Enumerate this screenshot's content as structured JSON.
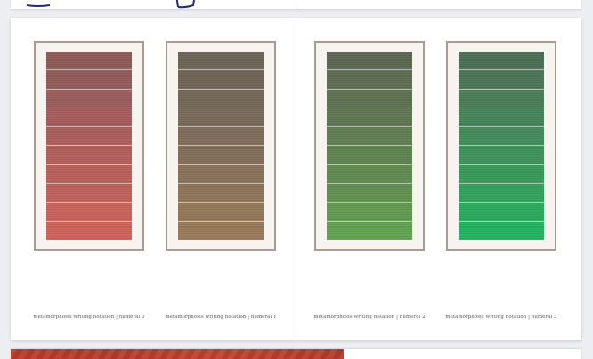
{
  "works": [
    {
      "caption": "metamorphosis writing notation | numeral 0",
      "bands": [
        "#8e5a55",
        "#93595a",
        "#9b5b5b",
        "#a35c5b",
        "#aa5d5b",
        "#b25e5a",
        "#b85f59",
        "#bf605a",
        "#c7615a",
        "#ce6258"
      ]
    },
    {
      "caption": "metamorphosis writing notation | numeral 1",
      "bands": [
        "#6b6454",
        "#6f6455",
        "#736756",
        "#786957",
        "#7d6b57",
        "#826e58",
        "#887158",
        "#8d7458",
        "#927757",
        "#977a57"
      ]
    },
    {
      "caption": "metamorphosis writing notation | numeral 2",
      "bands": [
        "#5b6650",
        "#5c6b50",
        "#5d7050",
        "#5e7650",
        "#5f7c50",
        "#5f8250",
        "#608950",
        "#609050",
        "#619850",
        "#62a050"
      ]
    },
    {
      "caption": "metamorphosis writing notation | numeral 3",
      "bands": [
        "#4a6e54",
        "#497554",
        "#477c55",
        "#448356",
        "#408a57",
        "#3c9158",
        "#37995a",
        "#30a15b",
        "#28aa5c",
        "#1fb35e"
      ]
    }
  ]
}
